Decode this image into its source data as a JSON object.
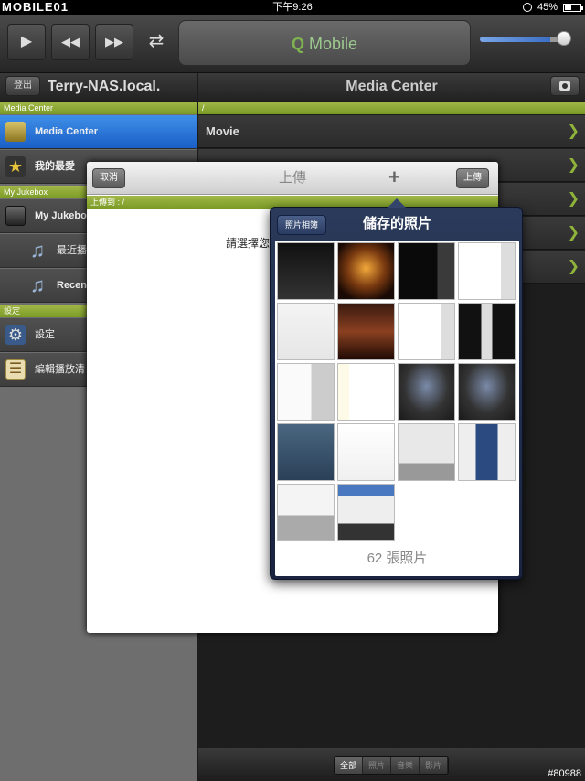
{
  "status_bar": {
    "mark": "MOBILE01",
    "time": "下午9:26",
    "battery": "45%",
    "battery_fraction": 0.45
  },
  "toolbar": {
    "play": "▶",
    "prev": "◀◀",
    "next": "▶▶",
    "shuffle": "⇄",
    "lcd_q": "Q",
    "lcd_text": "Mobile",
    "volume_fraction": 0.85
  },
  "left_header": {
    "logout": "登出",
    "host": "Terry-NAS.local."
  },
  "right_header": {
    "title": "Media Center"
  },
  "sidebar": {
    "sections": [
      "Media Center",
      "My Jukebox",
      "設定"
    ],
    "items": [
      {
        "label": "Media Center",
        "icon": "film-icon",
        "selected": true
      },
      {
        "label": "我的最愛",
        "icon": "star-icon"
      },
      {
        "label": "My Jukebox",
        "icon": "jukebox-icon"
      },
      {
        "label": "最近播",
        "icon": "music-note-icon"
      },
      {
        "label": "Recen",
        "icon": "music-note-icon"
      },
      {
        "label": "設定",
        "icon": "gear-icon"
      },
      {
        "label": "編輯播放清",
        "icon": "list-icon"
      }
    ]
  },
  "right_list": {
    "path": "/",
    "items": [
      {
        "label": "Movie"
      },
      {
        "label": ""
      },
      {
        "label": ""
      },
      {
        "label": ""
      },
      {
        "label": ""
      }
    ]
  },
  "bottom_bar": {
    "tabs": [
      "全部",
      "照片",
      "音樂",
      "影片"
    ],
    "selected": 0
  },
  "watermark": "#80988",
  "upload_dialog": {
    "cancel": "取消",
    "title": "上傳",
    "plus": "+",
    "upload": "上傳",
    "upload_to": "上傳到 : /",
    "prompt": "請選擇您"
  },
  "photo_picker": {
    "back": "照片相簿",
    "title": "儲存的照片",
    "count_label": "62 張照片",
    "thumbnails": [
      {
        "style": "dark-list"
      },
      {
        "style": "fox-logo"
      },
      {
        "style": "dark-panel"
      },
      {
        "style": "white-list"
      },
      {
        "style": "white-dialog"
      },
      {
        "style": "sunset"
      },
      {
        "style": "white-list"
      },
      {
        "style": "dark-bars"
      },
      {
        "style": "white-panel"
      },
      {
        "style": "white-sidebar"
      },
      {
        "style": "dark-dialog"
      },
      {
        "style": "dark-dialog"
      },
      {
        "style": "blue-sky"
      },
      {
        "style": "white-doc"
      },
      {
        "style": "keyboard"
      },
      {
        "style": "phone-ui"
      },
      {
        "style": "keyboard-form"
      },
      {
        "style": "blue-list"
      }
    ]
  },
  "colors": {
    "accent_green": "#8fb33a",
    "selection_blue": "#1b5fc7"
  }
}
